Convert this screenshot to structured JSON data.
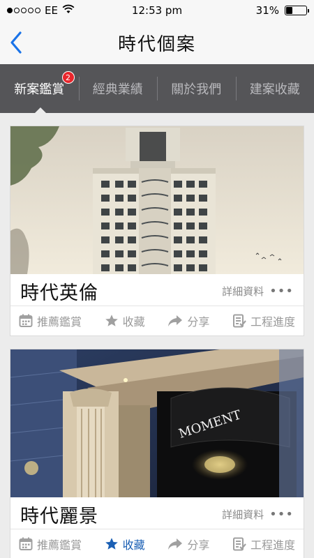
{
  "status_bar": {
    "carrier": "EE",
    "time": "12:53 pm",
    "battery_percent": "31%",
    "battery_level": 0.31,
    "signal_filled": 1,
    "signal_total": 5
  },
  "nav": {
    "title": "時代個案",
    "back_icon": "chevron-left-icon",
    "accent_color": "#1a73e8"
  },
  "tabs": [
    {
      "label": "新案鑑賞",
      "active": true,
      "badge": "2"
    },
    {
      "label": "經典業績",
      "active": false
    },
    {
      "label": "關於我們",
      "active": false
    },
    {
      "label": "建案收藏",
      "active": false
    }
  ],
  "cards": [
    {
      "title": "時代英倫",
      "details_label": "詳細資料",
      "more_label": "•••",
      "actions": {
        "recommend": "推薦鑑賞",
        "favorite": "收藏",
        "share": "分享",
        "progress": "工程進度"
      },
      "favorited": false
    },
    {
      "title": "時代麗景",
      "details_label": "詳細資料",
      "more_label": "•••",
      "sign_text": "MOMENT",
      "actions": {
        "recommend": "推薦鑑賞",
        "favorite": "收藏",
        "share": "分享",
        "progress": "工程進度"
      },
      "favorited": true
    }
  ],
  "colors": {
    "tab_bar_bg": "#555558",
    "badge": "#e8262c",
    "favorite_active": "#1a5fb4",
    "icon_inactive": "#a0a0a0"
  }
}
